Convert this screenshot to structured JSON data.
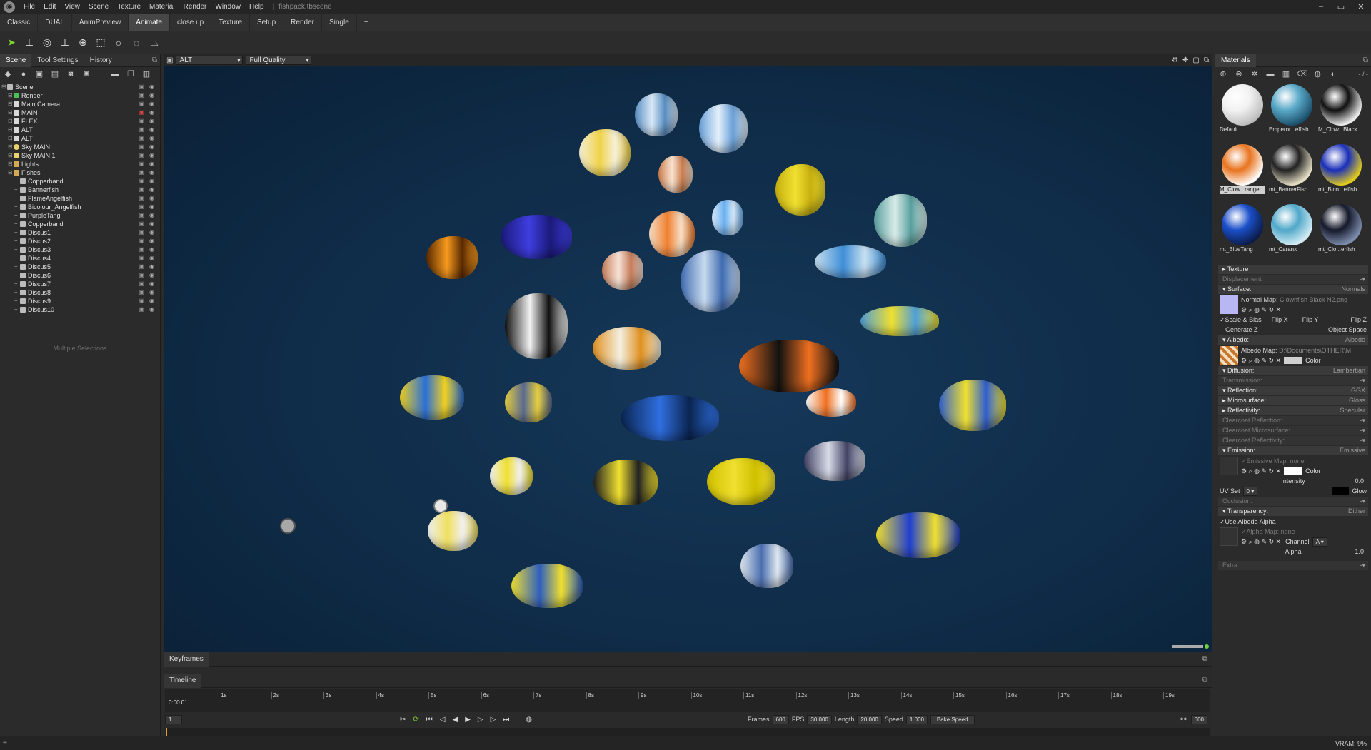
{
  "titlebar": {
    "menus": [
      "File",
      "Edit",
      "View",
      "Scene",
      "Texture",
      "Material",
      "Render",
      "Window",
      "Help"
    ],
    "separator": "|",
    "filename": "fishpack.tbscene",
    "window_controls": [
      "–",
      "▭",
      "✕"
    ]
  },
  "workspace_tabs": [
    "Classic",
    "DUAL",
    "AnimPreview",
    "Animate",
    "close up",
    "Texture",
    "Setup",
    "Render",
    "Single",
    "+"
  ],
  "left": {
    "tabs": [
      "Scene",
      "Tool Settings",
      "History"
    ],
    "tree": [
      {
        "label": "Scene",
        "depth": 0,
        "icon": "scene"
      },
      {
        "label": "Render",
        "depth": 1,
        "icon": "green"
      },
      {
        "label": "Main Camera",
        "depth": 1,
        "icon": "cam"
      },
      {
        "label": "MAIN",
        "depth": 1,
        "icon": "cam",
        "locked_red": true
      },
      {
        "label": "FLEX",
        "depth": 1,
        "icon": "cam"
      },
      {
        "label": "ALT",
        "depth": 1,
        "icon": "cam"
      },
      {
        "label": "ALT",
        "depth": 1,
        "icon": "cam"
      },
      {
        "label": "Sky MAIN",
        "depth": 1,
        "icon": "light"
      },
      {
        "label": "Sky MAIN 1",
        "depth": 1,
        "icon": "light"
      },
      {
        "label": "Lights",
        "depth": 1,
        "icon": "folder"
      },
      {
        "label": "Fishes",
        "depth": 1,
        "icon": "folder"
      },
      {
        "label": "Copperband",
        "depth": 2,
        "icon": "obj"
      },
      {
        "label": "Bannerfish",
        "depth": 2,
        "icon": "obj"
      },
      {
        "label": "FlameAngelfish",
        "depth": 2,
        "icon": "obj"
      },
      {
        "label": "Bicolour_Angelfish",
        "depth": 2,
        "icon": "obj"
      },
      {
        "label": "PurpleTang",
        "depth": 2,
        "icon": "obj"
      },
      {
        "label": "Copperband",
        "depth": 2,
        "icon": "obj"
      },
      {
        "label": "Discus1",
        "depth": 2,
        "icon": "obj"
      },
      {
        "label": "Discus2",
        "depth": 2,
        "icon": "obj"
      },
      {
        "label": "Discus3",
        "depth": 2,
        "icon": "obj"
      },
      {
        "label": "Discus4",
        "depth": 2,
        "icon": "obj"
      },
      {
        "label": "Discus5",
        "depth": 2,
        "icon": "obj"
      },
      {
        "label": "Discus6",
        "depth": 2,
        "icon": "obj"
      },
      {
        "label": "Discus7",
        "depth": 2,
        "icon": "obj"
      },
      {
        "label": "Discus8",
        "depth": 2,
        "icon": "obj"
      },
      {
        "label": "Discus9",
        "depth": 2,
        "icon": "obj"
      },
      {
        "label": "Discus10",
        "depth": 2,
        "icon": "obj"
      }
    ],
    "multi_selection": "Multiple Selections"
  },
  "viewport": {
    "camera": "ALT",
    "quality": "Full Quality"
  },
  "materials": {
    "title": "Materials",
    "counter": "- / -",
    "items": [
      {
        "name": "Default",
        "color": "#f2f2f2",
        "accent": "#bdbdbd"
      },
      {
        "name": "Emperor...elfish",
        "color": "#5aa9c8",
        "accent": "#1b4f6b"
      },
      {
        "name": "M_Clow...Black",
        "color": "#111111",
        "accent": "#f0f0f0"
      },
      {
        "name": "M_Clow...range",
        "color": "#e8731d",
        "accent": "#ffffff",
        "selected": true
      },
      {
        "name": "mt_BannerFish",
        "color": "#222222",
        "accent": "#e9e3c8"
      },
      {
        "name": "mt_Bico...elfish",
        "color": "#1a2fb8",
        "accent": "#e6cf1a"
      },
      {
        "name": "mt_BlueTang",
        "color": "#1b4fc9",
        "accent": "#0b1c4a"
      },
      {
        "name": "mt_Caranx",
        "color": "#4fa7c9",
        "accent": "#d6eef5"
      },
      {
        "name": "mt_Clo...erfish",
        "color": "#15192a",
        "accent": "#7f8fb0"
      }
    ],
    "sections": {
      "texture": "Texture",
      "displacement": "Displacement:",
      "surface": "Surface:",
      "surface_val": "Normals",
      "normal_map_label": "Normal Map:",
      "normal_map_file": "Clownfish Black N2.png",
      "scale_bias": "Scale & Bias",
      "flip_x": "Flip X",
      "flip_y": "Flip Y",
      "flip_z": "Flip Z",
      "generate_z": "Generate Z",
      "object_space": "Object Space",
      "albedo": "Albedo:",
      "albedo_val": "Albedo",
      "albedo_map_label": "Albedo Map:",
      "albedo_map_file": "D:\\Documents\\OTHER\\M",
      "color": "Color",
      "diffusion": "Diffusion:",
      "diffusion_val": "Lambertian",
      "transmission": "Transmission:",
      "reflection": "Reflection:",
      "reflection_val": "GGX",
      "microsurface": "Microsurface:",
      "microsurface_val": "Gloss",
      "reflectivity": "Reflectivity:",
      "reflectivity_val": "Specular",
      "clearcoat_reflection": "Clearcoat Reflection:",
      "clearcoat_microsurface": "Clearcoat Microsurface:",
      "clearcoat_reflectivity": "Clearcoat Reflectivity:",
      "emission": "Emission:",
      "emission_val": "Emissive",
      "emissive_map_label": "Emissive Map:",
      "emissive_map_file": "none",
      "intensity": "Intensity",
      "intensity_val": "0.0",
      "uv_set": "UV Set",
      "uv_set_val": "0",
      "glow": "Glow",
      "occlusion": "Occlusion:",
      "transparency": "Transparency:",
      "transparency_val": "Dither",
      "use_albedo_alpha": "Use Albedo Alpha",
      "alpha_map_label": "Alpha Map:",
      "alpha_map_file": "none",
      "channel": "Channel",
      "channel_val": "A",
      "alpha": "Alpha",
      "alpha_val": "1.0",
      "extra": "Extra:"
    }
  },
  "bottom": {
    "keyframes_tab": "Keyframes",
    "timeline_tab": "Timeline",
    "start_time": "0:00.01",
    "ticks": [
      "1s",
      "2s",
      "3s",
      "4s",
      "5s",
      "6s",
      "7s",
      "8s",
      "9s",
      "10s",
      "11s",
      "12s",
      "13s",
      "14s",
      "15s",
      "16s",
      "17s",
      "18s",
      "19s"
    ],
    "frame_field": "1",
    "frames_label": "Frames",
    "frames_val": "600",
    "fps_label": "FPS",
    "fps_val": "30.000",
    "length_label": "Length",
    "length_val": "20.000",
    "speed_label": "Speed",
    "speed_val": "1.000",
    "bake_speed": "Bake Speed",
    "end_frame": "600"
  },
  "status": {
    "vram": "VRAM: 9%"
  }
}
